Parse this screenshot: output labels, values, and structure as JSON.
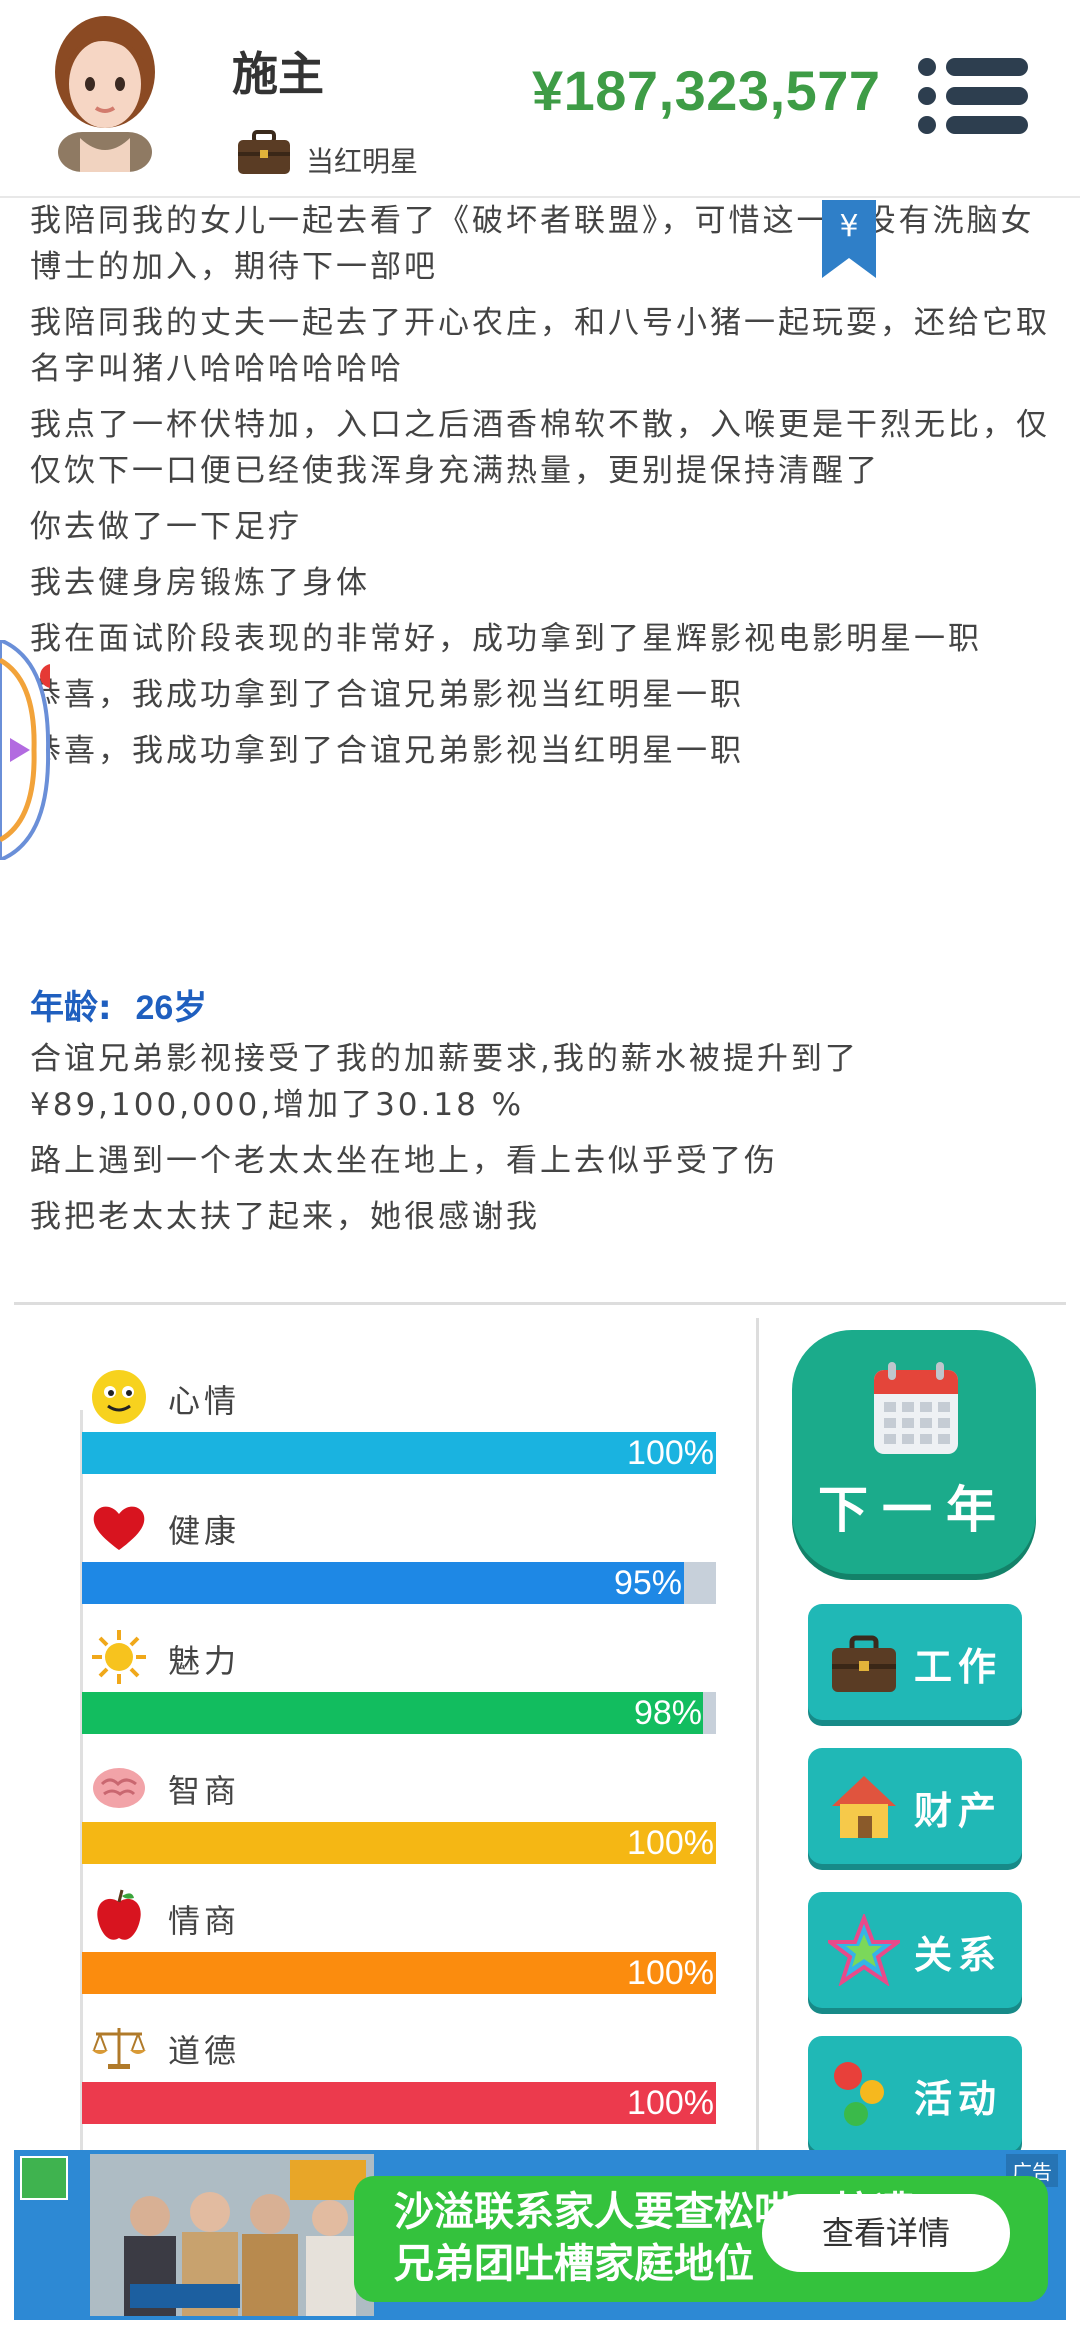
{
  "header": {
    "name": "施主",
    "job_title": "当红明星",
    "money": "¥187,323,577",
    "icons": {
      "avatar": "female-avatar",
      "job": "briefcase-icon",
      "menu": "menu-icon"
    }
  },
  "log": {
    "lines": [
      "我陪同我的女儿一起去看了《破坏者联盟》，可惜这一部没有洗脑女博士的加入，期待下一部吧",
      "我陪同我的丈夫一起去了开心农庄，和八号小猪一起玩耍，还给它取名字叫猪八哈哈哈哈哈哈",
      "我点了一杯伏特加，入口之后酒香棉软不散，入喉更是干烈无比，仅仅饮下一口便已经使我浑身充满热量，更别提保持清醒了",
      "你去做了一下足疗",
      "我去健身房锻炼了身体",
      "我在面试阶段表现的非常好，成功拿到了星辉影视电影明星一职",
      "恭喜，我成功拿到了合谊兄弟影视当红明星一职",
      "恭喜，我成功拿到了合谊兄弟影视当红明星一职"
    ],
    "age_label": "年龄:",
    "age_value": "26岁",
    "lines2": [
      "合谊兄弟影视接受了我的加薪要求,我的薪水被提升到了¥89,100,000,增加了30.18 %",
      "路上遇到一个老太太坐在地上，看上去似乎受了伤",
      "我把老太太扶了起来，她很感谢我"
    ]
  },
  "stats": [
    {
      "label": "心情",
      "value": 100,
      "text": "100%",
      "color": "#1ab3e0",
      "icon": "smiley-icon"
    },
    {
      "label": "健康",
      "value": 95,
      "text": "95%",
      "color": "#1e88e5",
      "icon": "heart-icon"
    },
    {
      "label": "魅力",
      "value": 98,
      "text": "98%",
      "color": "#12bd5f",
      "icon": "sun-icon"
    },
    {
      "label": "智商",
      "value": 100,
      "text": "100%",
      "color": "#f5b714",
      "icon": "brain-icon"
    },
    {
      "label": "情商",
      "value": 100,
      "text": "100%",
      "color": "#fb8c0e",
      "icon": "apple-icon"
    },
    {
      "label": "道德",
      "value": 100,
      "text": "100%",
      "color": "#ec3a4d",
      "icon": "scales-icon"
    }
  ],
  "buttons": {
    "next_year": "下一年",
    "work": "工作",
    "property": "财产",
    "relations": "关系",
    "activity": "活动"
  },
  "ad": {
    "tag": "广告",
    "text_line1": "沙溢联系家人要查松哄，惊遭",
    "text_line2": "兄弟团吐槽家庭地位",
    "button": "查看详情"
  }
}
